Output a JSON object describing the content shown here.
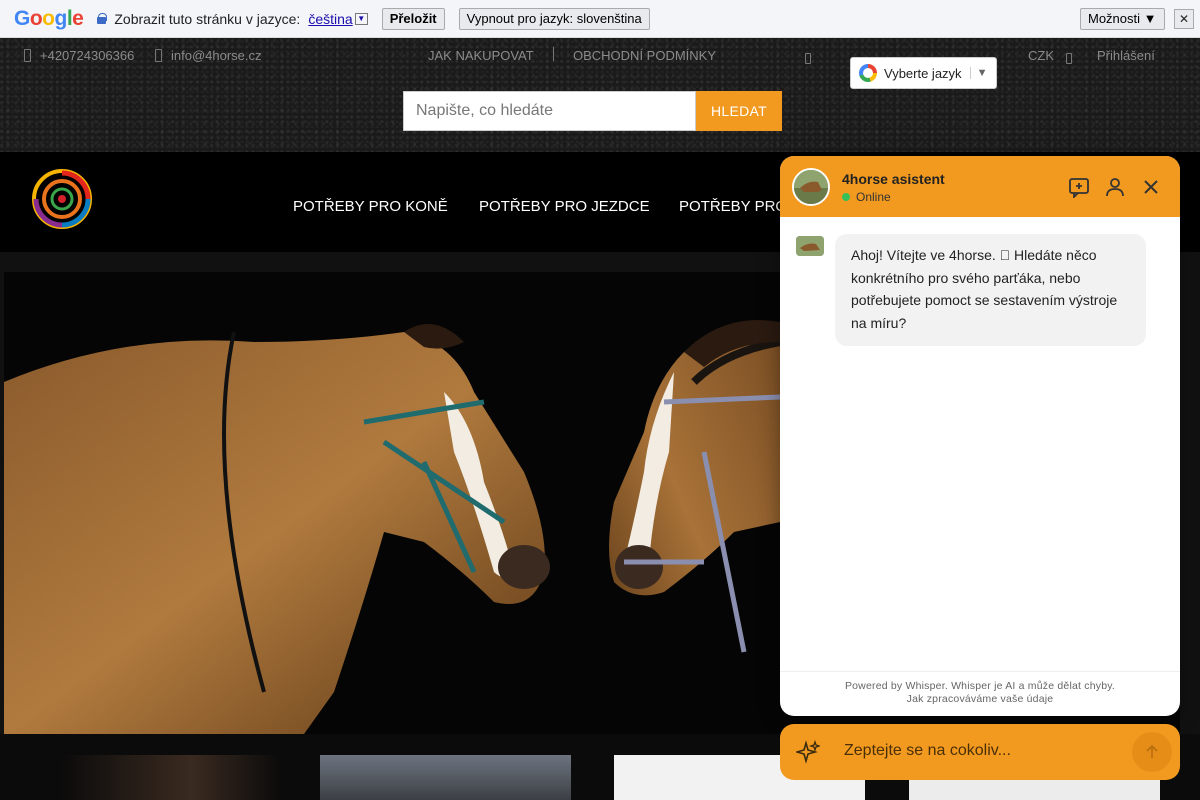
{
  "translate_bar": {
    "logo": [
      "G",
      "o",
      "o",
      "g",
      "l",
      "e"
    ],
    "prompt": "Zobrazit tuto stránku v jazyce:",
    "language": "čeština",
    "dropdown_arrow": "▼",
    "translate_button": "Přeložit",
    "disable_button": "Vypnout pro jazyk: slovenština",
    "options_button": "Možnosti ▼",
    "close": "✕"
  },
  "top_links": {
    "phone": "+420724306366",
    "email": "info@4horse.cz",
    "how_to_buy": "JAK NAKUPOVAT",
    "terms": "OBCHODNÍ PODMÍNKY",
    "currency": "CZK",
    "login": "Přihlášení"
  },
  "language_selector": {
    "label": "Vyberte jazyk",
    "arrow": "▼"
  },
  "search": {
    "placeholder": "Napište, co hledáte",
    "button": "HLEDAT"
  },
  "nav": {
    "items": [
      "POTŘEBY PRO KONĚ",
      "POTŘEBY PRO JEZDCE",
      "POTŘEBY PRO"
    ]
  },
  "chat": {
    "title": "4horse asistent",
    "status": "Online",
    "message": "Ahoj! Vítejte ve 4horse.  Hledáte něco konkrétního pro svého parťáka, nebo potřebujete pomoct se sestavením výstroje na míru?",
    "footer_line1": "Powered by Whisper. Whisper je AI a může dělat chyby.",
    "footer_line2": "Jak zpracováváme vaše údaje",
    "input_placeholder": "Zeptejte se na cokoliv..."
  },
  "colors": {
    "accent": "#f29a1f",
    "google_blue": "#4285f4",
    "google_red": "#ea4335",
    "google_yellow": "#fbbc05",
    "google_green": "#34a853",
    "online": "#36c05a"
  },
  "icons": [
    "lock-icon",
    "phone-icon",
    "mail-icon",
    "cart-icon",
    "user-icon",
    "google-g-icon",
    "new-chat-icon",
    "profile-icon",
    "close-icon",
    "sparkle-icon",
    "send-arrow-icon"
  ]
}
